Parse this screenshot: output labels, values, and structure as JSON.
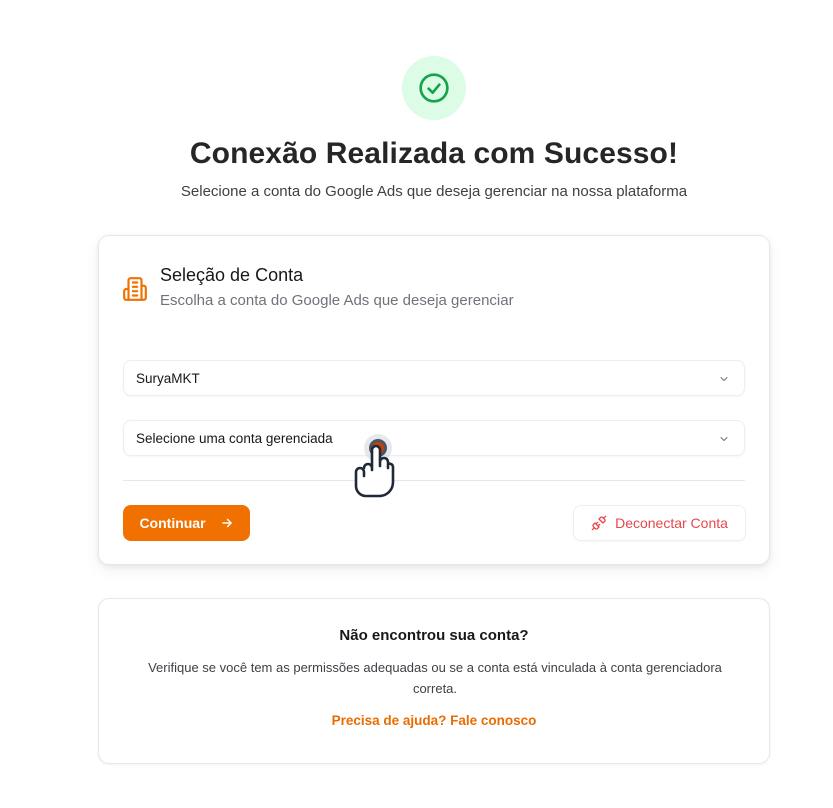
{
  "header": {
    "icon": "check-circle-icon",
    "title": "Conexão Realizada com Sucesso!",
    "subtitle": "Selecione a conta do Google Ads que deseja gerenciar na nossa plataforma"
  },
  "account_card": {
    "icon": "building-icon",
    "title": "Seleção de Conta",
    "subtitle": "Escolha a conta do Google Ads que deseja gerenciar",
    "account_select": {
      "value": "SuryaMKT",
      "icon": "chevron-down-icon"
    },
    "managed_select": {
      "placeholder": "Selecione uma conta gerenciada",
      "icon": "chevron-down-icon"
    },
    "continue_label": "Continuar",
    "continue_icon": "arrow-right-icon",
    "disconnect_label": "Deconectar Conta",
    "disconnect_icon": "unplug-icon"
  },
  "help_card": {
    "title": "Não encontrou sua conta?",
    "text": "Verifique se você tem as permissões adequadas ou se a conta está vinculada à conta gerenciadora correta.",
    "link": "Precisa de ajuda? Fale conosco"
  },
  "colors": {
    "accent": "#f07000",
    "success_bg": "#dcfce7",
    "success_icon": "#16a34a",
    "danger": "#e5484d"
  }
}
